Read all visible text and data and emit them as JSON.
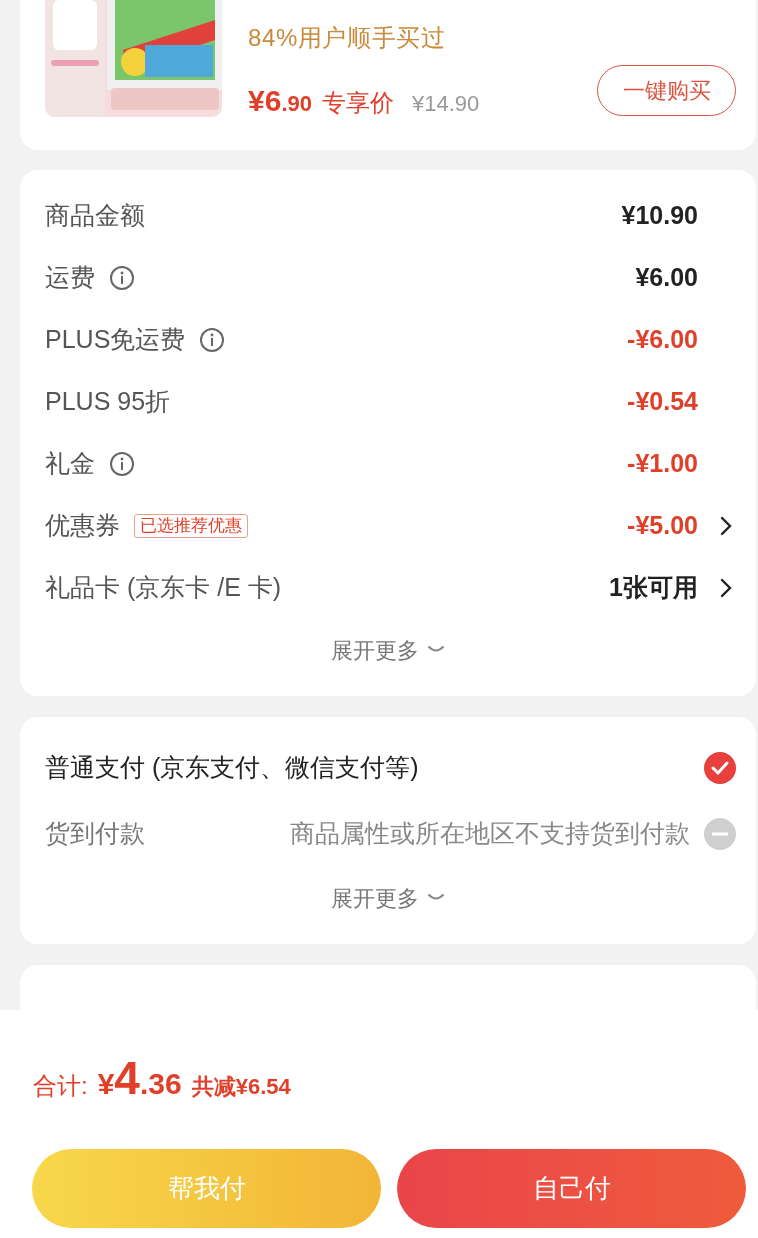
{
  "product": {
    "subtitle": "84%用户顺手买过",
    "price_integer": "¥6",
    "price_fraction": ".90",
    "price_label": "专享价",
    "original_price": "¥14.90",
    "buy_button": "一键购买"
  },
  "summary": {
    "rows": [
      {
        "label": "商品金额",
        "info": false,
        "kind": "normal",
        "value": "¥10.90",
        "arrow": false
      },
      {
        "label": "运费",
        "info": true,
        "kind": "normal",
        "value": "¥6.00",
        "arrow": false
      },
      {
        "label": "PLUS免运费",
        "info": true,
        "kind": "discount",
        "value": "-¥6.00",
        "arrow": false
      },
      {
        "label": "PLUS 95折",
        "info": false,
        "kind": "discount",
        "value": "-¥0.54",
        "arrow": false
      },
      {
        "label": "礼金",
        "info": true,
        "kind": "discount",
        "value": "-¥1.00",
        "arrow": false
      },
      {
        "label": "优惠券",
        "info": false,
        "tag": "已选推荐优惠",
        "kind": "discount",
        "value": "-¥5.00",
        "arrow": true
      },
      {
        "label": "礼品卡 (京东卡 /E 卡)",
        "info": false,
        "kind": "normal",
        "value": "1张可用",
        "arrow": true
      }
    ],
    "expand": "展开更多"
  },
  "payment": {
    "options": [
      {
        "label": "普通支付 (京东支付、微信支付等)",
        "selected": true,
        "disabled": false
      },
      {
        "label": "货到付款",
        "note": "商品属性或所在地区不支持货到付款",
        "selected": false,
        "disabled": true
      }
    ],
    "expand": "展开更多"
  },
  "footer": {
    "total_label": "合计:",
    "total_currency": "¥",
    "total_integer": "4",
    "total_fraction": ".36",
    "savings": "共减¥6.54",
    "buttons": [
      {
        "label": "帮我付",
        "kind": "secondary"
      },
      {
        "label": "自己付",
        "kind": "primary"
      }
    ]
  }
}
